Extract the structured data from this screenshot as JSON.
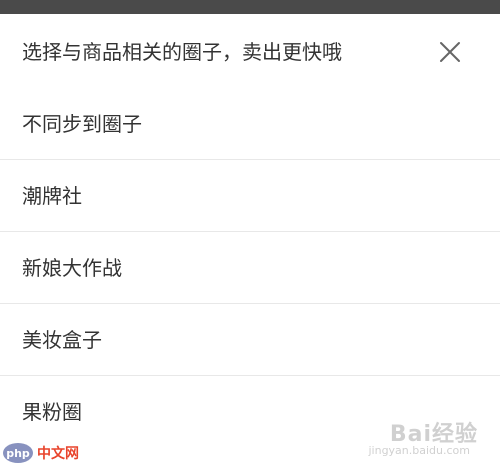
{
  "header": {
    "title": "选择与商品相关的圈子，卖出更快哦",
    "close_icon": "close-icon"
  },
  "options": [
    {
      "label": "不同步到圈子"
    },
    {
      "label": "潮牌社"
    },
    {
      "label": "新娘大作战"
    },
    {
      "label": "美妆盒子"
    },
    {
      "label": "果粉圈"
    }
  ],
  "watermark": {
    "left_logo": "php",
    "left_text": "中文网",
    "right_text": "Bai经验",
    "right_sub": "jingyan.baidu.com"
  },
  "colors": {
    "text": "#333333",
    "divider": "#e8e8e8",
    "background": "#ffffff",
    "top_strip": "#4a4a4a",
    "close_icon": "#666666"
  }
}
